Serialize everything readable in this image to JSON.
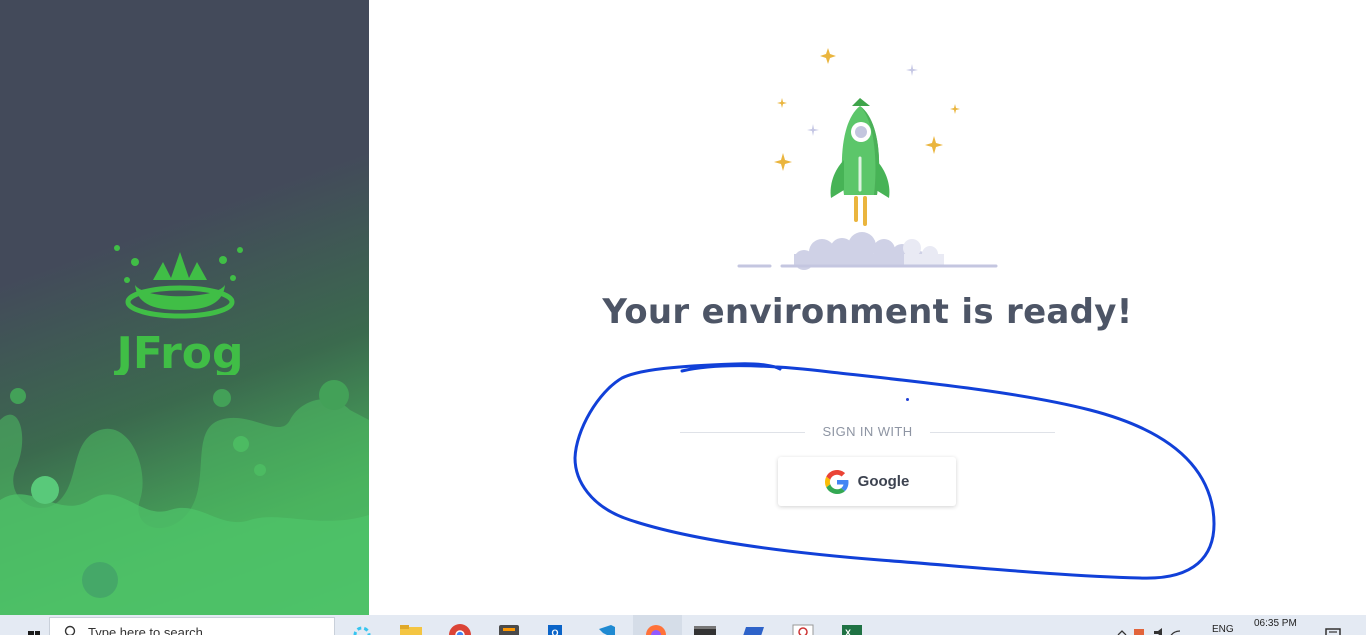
{
  "brand": {
    "name": "JFrog",
    "primary_green": "#40be46",
    "panel_dark": "#434a5a"
  },
  "main": {
    "illustration": "rocket-launch",
    "title": "Your environment is ready!",
    "divider_label": "SIGN IN WITH",
    "google_button_label": "Google"
  },
  "annotation": {
    "shape": "freehand-ellipse",
    "color": "#1140d8"
  },
  "taskbar": {
    "search_placeholder": "Type here to search",
    "pinned_apps": [
      "slack-icon",
      "file-explorer-icon",
      "chrome-icon",
      "sublime-text-icon",
      "outlook-icon",
      "vscode-icon",
      "firefox-icon",
      "terminal-icon",
      "powershell-icon",
      "recorder-icon",
      "excel-icon"
    ],
    "language": "ENG",
    "time": "06:35 PM"
  }
}
